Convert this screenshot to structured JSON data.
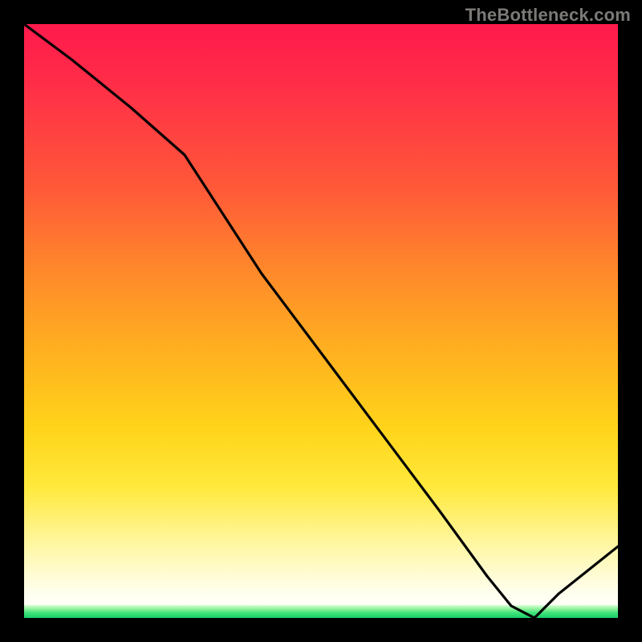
{
  "watermark": "TheBottleneck.com",
  "axis_label": "",
  "tiny_label": "",
  "colors": {
    "frame": "#000000",
    "grad_top": "#ff1a4c",
    "grad_mid": "#ffd41a",
    "grad_bottom": "#fffff0",
    "green": "#18cf6a",
    "curve": "#000000"
  },
  "chart_data": {
    "type": "line",
    "title": "",
    "xlabel": "",
    "ylabel": "",
    "xlim": [
      0,
      100
    ],
    "ylim": [
      0,
      100
    ],
    "series": [
      {
        "name": "bottleneck-curve",
        "x": [
          0,
          8,
          18,
          27,
          40,
          55,
          70,
          78,
          82,
          86,
          90,
          100
        ],
        "values": [
          100,
          94,
          86,
          78,
          58,
          38,
          18,
          7,
          2,
          0,
          4,
          12
        ]
      }
    ],
    "annotations": [
      {
        "name": "trough-label",
        "x": 84,
        "y": 1,
        "text": ""
      }
    ],
    "background_gradient": {
      "direction": "vertical",
      "stops": [
        {
          "pct": 0,
          "color": "#ff1a4c"
        },
        {
          "pct": 28,
          "color": "#ff5a38"
        },
        {
          "pct": 55,
          "color": "#ffb020"
        },
        {
          "pct": 78,
          "color": "#ffe93c"
        },
        {
          "pct": 96,
          "color": "#fffff0"
        },
        {
          "pct": 100,
          "color": "#18cf6a"
        }
      ]
    }
  }
}
